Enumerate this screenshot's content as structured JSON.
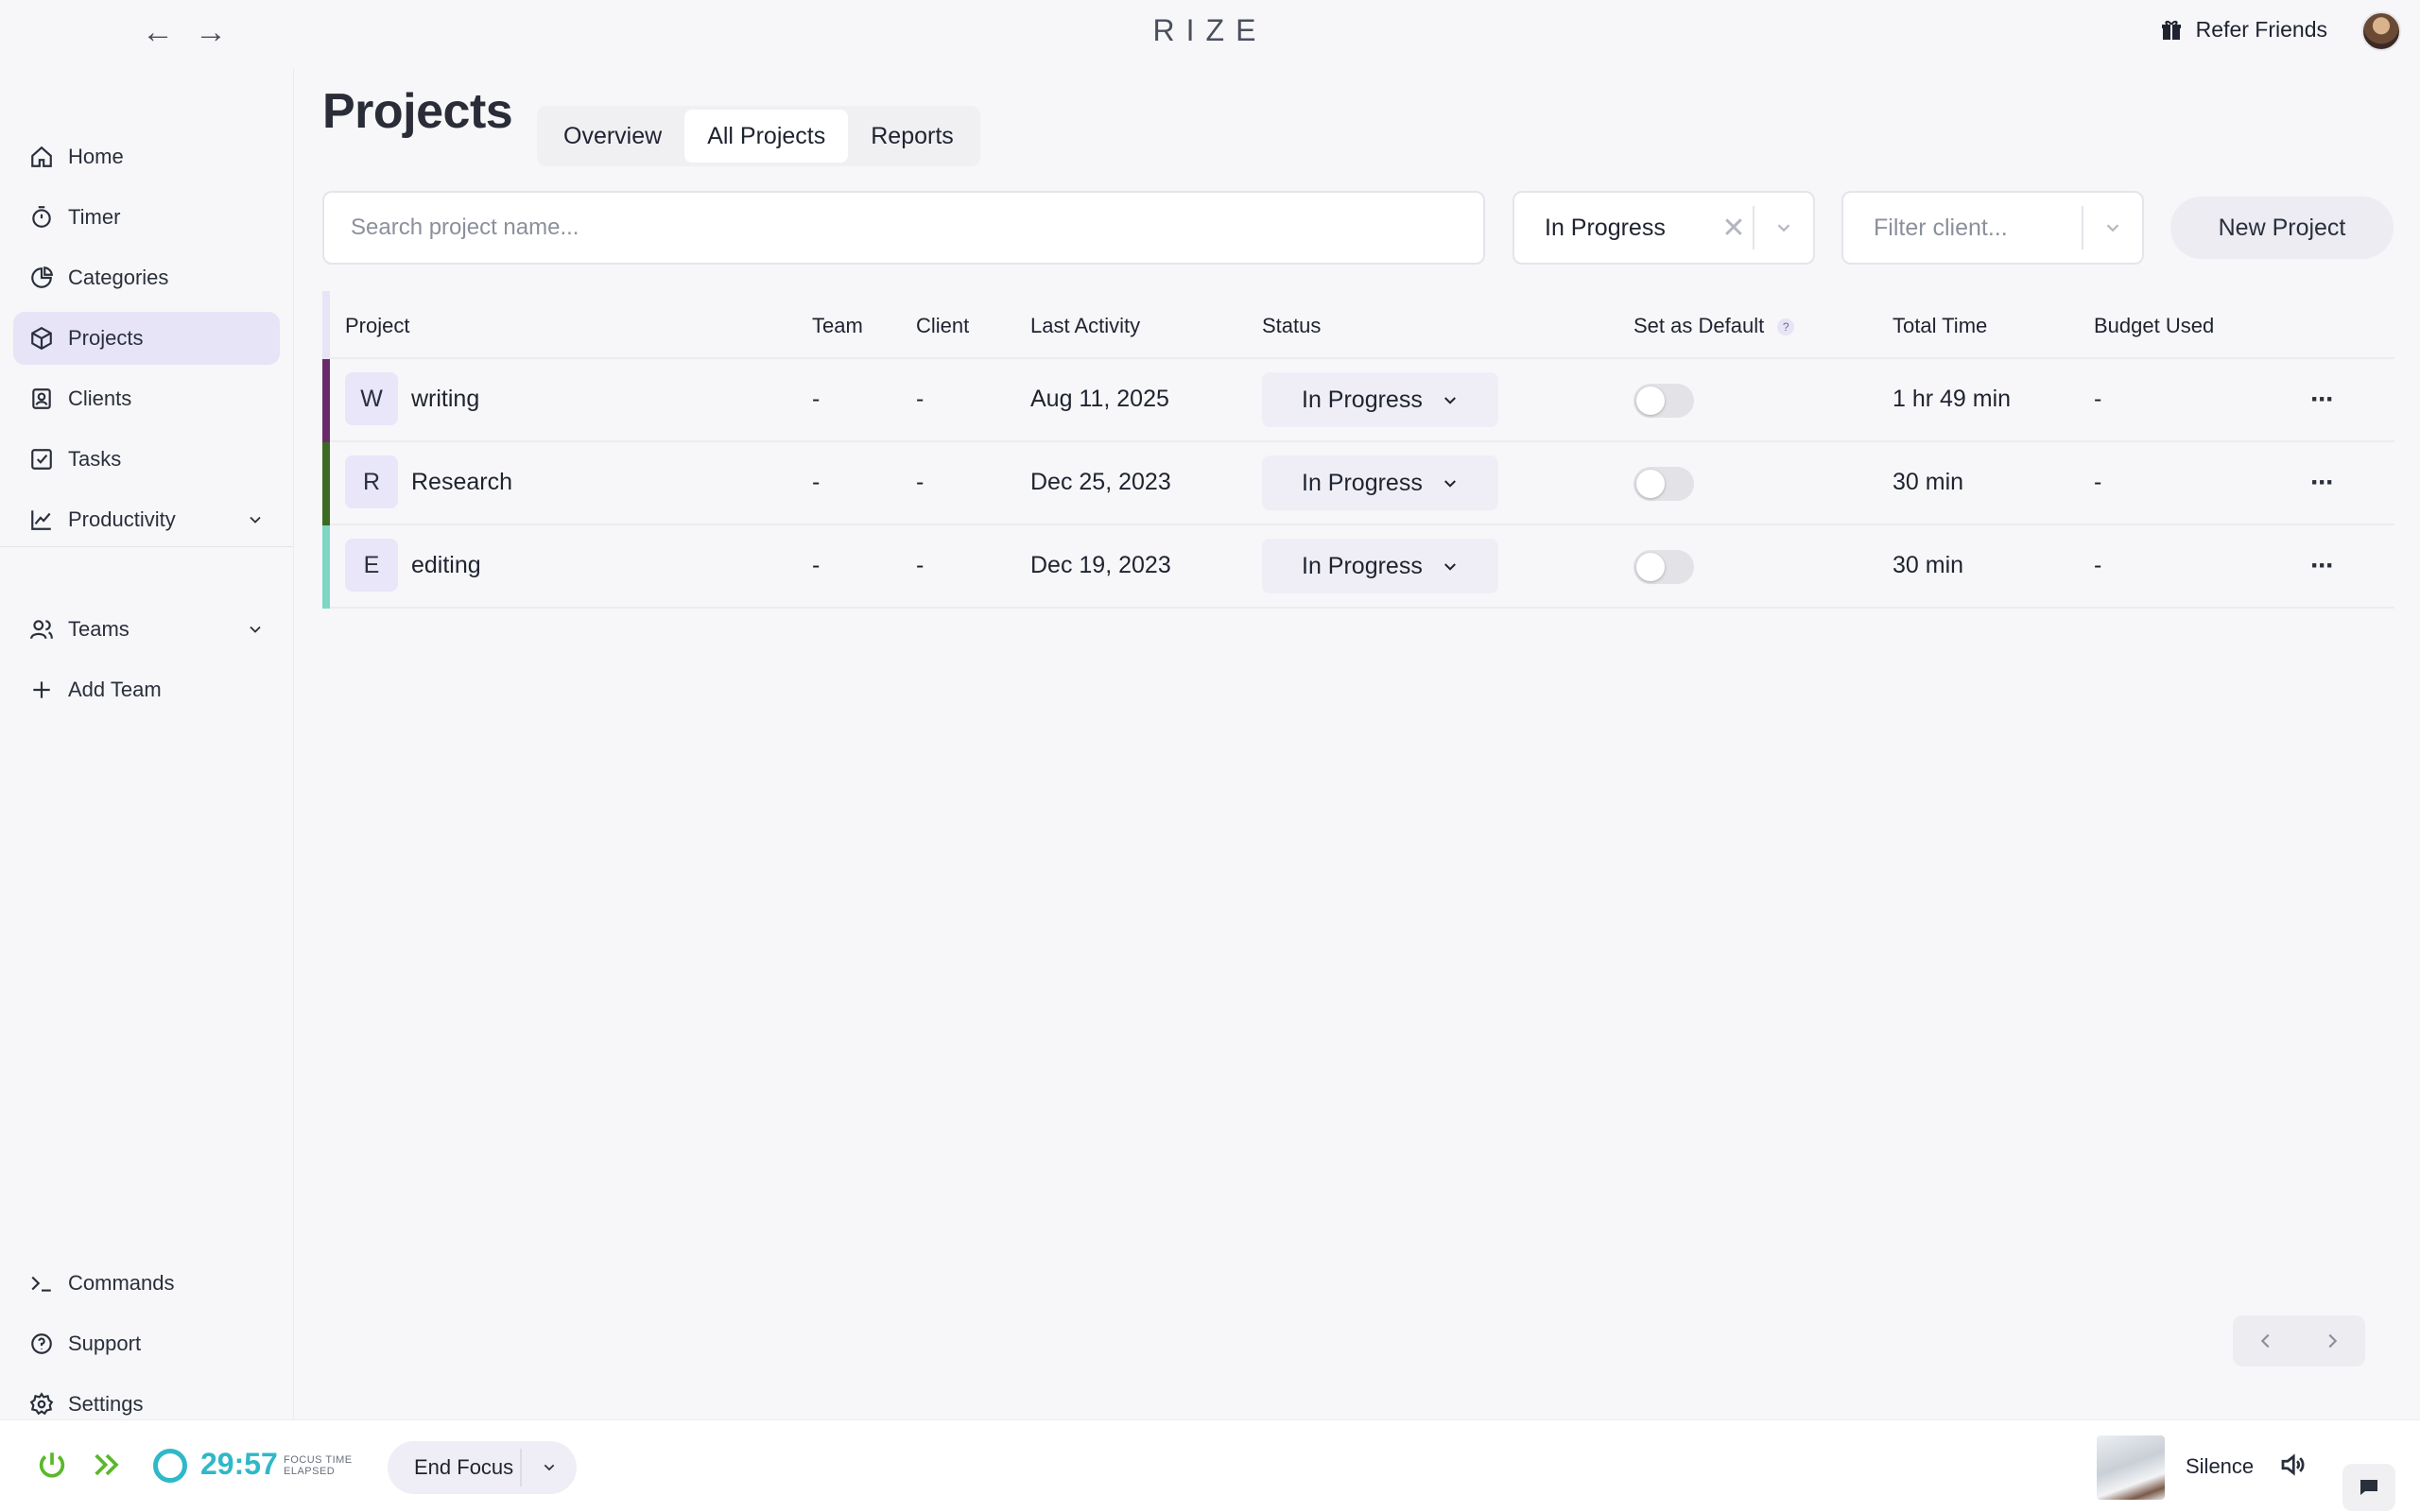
{
  "app": {
    "brand": "RIZE",
    "back_icon": "←",
    "forward_icon": "→",
    "refer_label": "Refer Friends"
  },
  "sidebar": {
    "items": [
      {
        "label": "Home",
        "icon": "home-icon"
      },
      {
        "label": "Timer",
        "icon": "stopwatch-icon"
      },
      {
        "label": "Categories",
        "icon": "pie-chart-icon"
      },
      {
        "label": "Projects",
        "icon": "cube-icon",
        "active": true
      },
      {
        "label": "Clients",
        "icon": "contact-icon"
      },
      {
        "label": "Tasks",
        "icon": "checkbox-icon"
      },
      {
        "label": "Productivity",
        "icon": "line-chart-icon"
      },
      {
        "label": "Teams",
        "icon": "users-icon"
      },
      {
        "label": "Add Team",
        "icon": "plus-icon"
      },
      {
        "label": "Commands",
        "icon": "terminal-icon"
      },
      {
        "label": "Support",
        "icon": "help-circle-icon"
      },
      {
        "label": "Settings",
        "icon": "gear-icon"
      }
    ]
  },
  "main": {
    "title": "Projects",
    "tabs": [
      {
        "label": "Overview",
        "active": false
      },
      {
        "label": "All Projects",
        "active": true
      },
      {
        "label": "Reports",
        "active": false
      }
    ],
    "search_placeholder": "Search project name...",
    "status_filter_value": "In Progress",
    "status_clear": "✕",
    "client_filter_placeholder": "Filter client...",
    "new_project_label": "New Project"
  },
  "table": {
    "columns": {
      "project": "Project",
      "team": "Team",
      "client": "Client",
      "last_activity": "Last Activity",
      "status": "Status",
      "set_default": "Set as Default",
      "set_default_help": "?",
      "total_time": "Total Time",
      "budget_used": "Budget Used"
    },
    "rows": [
      {
        "letter": "W",
        "name": "writing",
        "color": "#6a2a6a",
        "team": "-",
        "client": "-",
        "last_activity": "Aug 11, 2025",
        "status": "In Progress",
        "default": false,
        "total_time": "1 hr 49 min",
        "budget": "-",
        "more": "···"
      },
      {
        "letter": "R",
        "name": "Research",
        "color": "#3c6a22",
        "team": "-",
        "client": "-",
        "last_activity": "Dec 25, 2023",
        "status": "In Progress",
        "default": false,
        "total_time": "30 min",
        "budget": "-",
        "more": "···"
      },
      {
        "letter": "E",
        "name": "editing",
        "color": "#7fd6c4",
        "team": "-",
        "client": "-",
        "last_activity": "Dec 19, 2023",
        "status": "In Progress",
        "default": false,
        "total_time": "30 min",
        "budget": "-",
        "more": "···"
      }
    ]
  },
  "bottom": {
    "timer": "29:57",
    "timer_label_line1": "FOCUS TIME",
    "timer_label_line2": "ELAPSED",
    "end_focus_label": "End Focus",
    "music_title": "Silence",
    "accent_green": "#5ab82a",
    "accent_teal": "#2fb8c8"
  }
}
